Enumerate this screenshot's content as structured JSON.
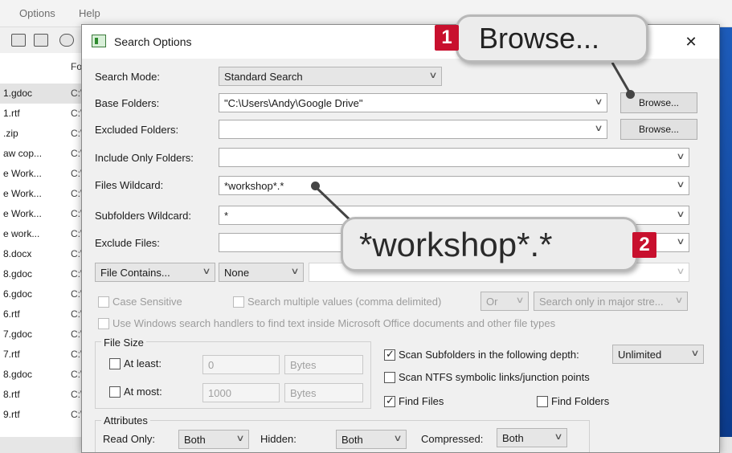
{
  "background_app": {
    "menu": [
      "Options",
      "Help"
    ],
    "column_header": "Fo",
    "files": [
      {
        "name": "1.gdoc",
        "path": "C:\\"
      },
      {
        "name": "1.rtf",
        "path": "C:\\"
      },
      {
        "name": ".zip",
        "path": "C:\\"
      },
      {
        "name": "aw cop...",
        "path": "C:\\"
      },
      {
        "name": "e Work...",
        "path": "C:\\"
      },
      {
        "name": "e Work...",
        "path": "C:\\"
      },
      {
        "name": "e Work...",
        "path": "C:\\"
      },
      {
        "name": "e work...",
        "path": "C:\\"
      },
      {
        "name": "8.docx",
        "path": "C:\\"
      },
      {
        "name": "8.gdoc",
        "path": "C:\\"
      },
      {
        "name": "6.gdoc",
        "path": "C:\\"
      },
      {
        "name": "6.rtf",
        "path": "C:\\"
      },
      {
        "name": "7.gdoc",
        "path": "C:\\"
      },
      {
        "name": "7.rtf",
        "path": "C:\\"
      },
      {
        "name": "8.gdoc",
        "path": "C:\\"
      },
      {
        "name": "8.rtf",
        "path": "C:\\"
      },
      {
        "name": "9.rtf",
        "path": "C:\\"
      }
    ]
  },
  "dialog": {
    "title": "Search Options",
    "close_glyph": "✕",
    "search_mode": {
      "label": "Search Mode:",
      "value": "Standard Search"
    },
    "base_folders": {
      "label": "Base Folders:",
      "value": "\"C:\\Users\\Andy\\Google Drive\"",
      "button": "Browse..."
    },
    "excluded_folders": {
      "label": "Excluded Folders:",
      "value": "",
      "button": "Browse..."
    },
    "include_only_folders": {
      "label": "Include Only Folders:",
      "value": ""
    },
    "files_wildcard": {
      "label": "Files Wildcard:",
      "value": "*workshop*.*"
    },
    "subfolders_wildcard": {
      "label": "Subfolders Wildcard:",
      "value": "*"
    },
    "exclude_files": {
      "label": "Exclude Files:",
      "value": ""
    },
    "file_contains": {
      "value": "File Contains...",
      "mode": "None"
    },
    "case_sensitive": "Case Sensitive",
    "search_multiple": "Search multiple values (comma delimited)",
    "or_value": "Or",
    "search_major": "Search only in major stre...",
    "use_windows_handlers": "Use Windows search handlers to find text inside Microsoft Office documents and other file types",
    "file_size": {
      "legend": "File Size",
      "at_least": {
        "label": "At least:",
        "value": "0",
        "unit": "Bytes"
      },
      "at_most": {
        "label": "At most:",
        "value": "1000",
        "unit": "Bytes"
      }
    },
    "scan_subfolders": {
      "label": "Scan Subfolders in the following depth:",
      "depth": "Unlimited",
      "checked": true
    },
    "scan_ntfs": {
      "label": "Scan NTFS symbolic links/junction points",
      "checked": false
    },
    "find_files": {
      "label": "Find Files",
      "checked": true
    },
    "find_folders": {
      "label": "Find Folders",
      "checked": false
    },
    "attributes": {
      "legend": "Attributes",
      "read_only": {
        "label": "Read Only:",
        "value": "Both"
      },
      "hidden": {
        "label": "Hidden:",
        "value": "Both"
      },
      "compressed": {
        "label": "Compressed:",
        "value": "Both"
      }
    }
  },
  "callouts": [
    {
      "number": "1",
      "text": "Browse..."
    },
    {
      "number": "2",
      "text": "*workshop*.*"
    }
  ],
  "colors": {
    "badge": "#c8102e",
    "accent_blue": "#1f5fbf"
  }
}
